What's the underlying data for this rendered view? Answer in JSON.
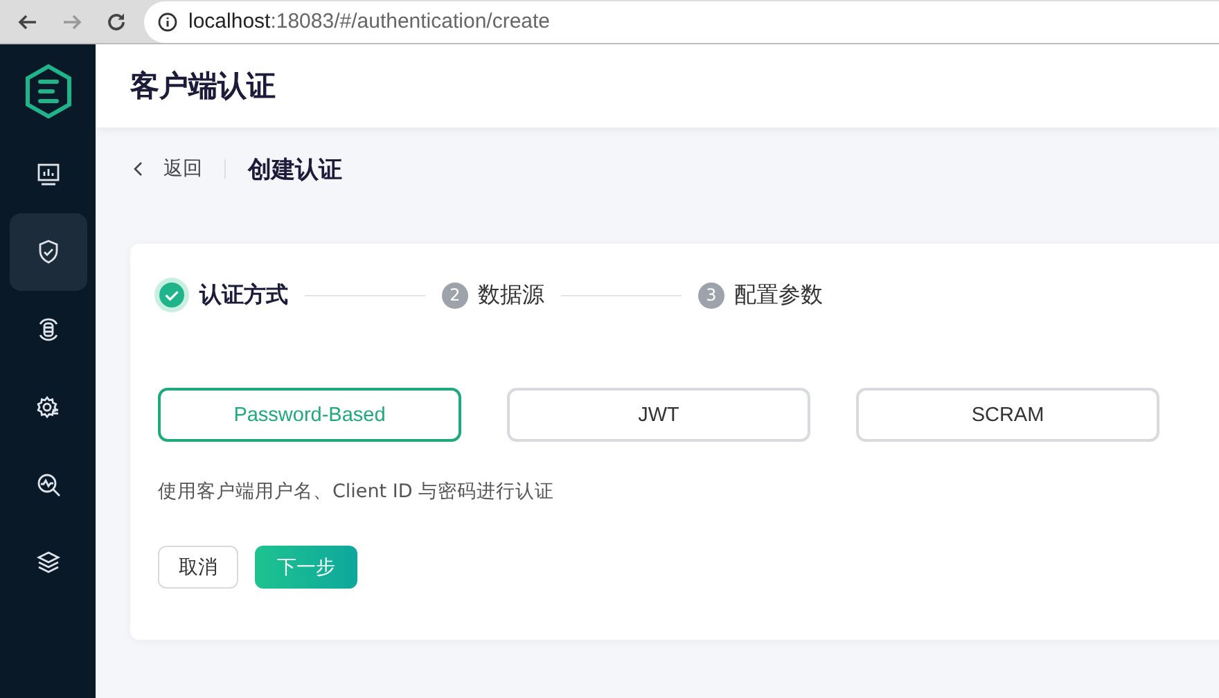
{
  "browser": {
    "nav": [
      {
        "kind": "back",
        "disabled": false
      },
      {
        "kind": "forward",
        "disabled": true
      },
      {
        "kind": "reload",
        "disabled": false
      }
    ],
    "url_host": "localhost",
    "url_rest": ":18083/#/authentication/create"
  },
  "sidebar": {
    "items": [
      {
        "selected": false
      },
      {
        "selected": true
      },
      {
        "selected": false
      },
      {
        "selected": false
      },
      {
        "selected": false
      },
      {
        "selected": false
      }
    ]
  },
  "header": {
    "title": "客户端认证"
  },
  "breadcrumb": {
    "back": "返回",
    "title": "创建认证"
  },
  "steps": [
    {
      "label": "认证方式",
      "completed": true
    },
    {
      "label": "数据源",
      "completed": false,
      "number": "2"
    },
    {
      "label": "配置参数",
      "completed": false,
      "number": "3"
    }
  ],
  "methods": [
    {
      "label": "Password-Based",
      "selected": true
    },
    {
      "label": "JWT",
      "selected": false
    },
    {
      "label": "SCRAM",
      "selected": false
    }
  ],
  "description": "使用客户端用户名、Client ID 与密码进行认证",
  "buttons": [
    {
      "label": "取消",
      "kind": "secondary"
    },
    {
      "label": "下一步",
      "kind": "primary"
    }
  ]
}
